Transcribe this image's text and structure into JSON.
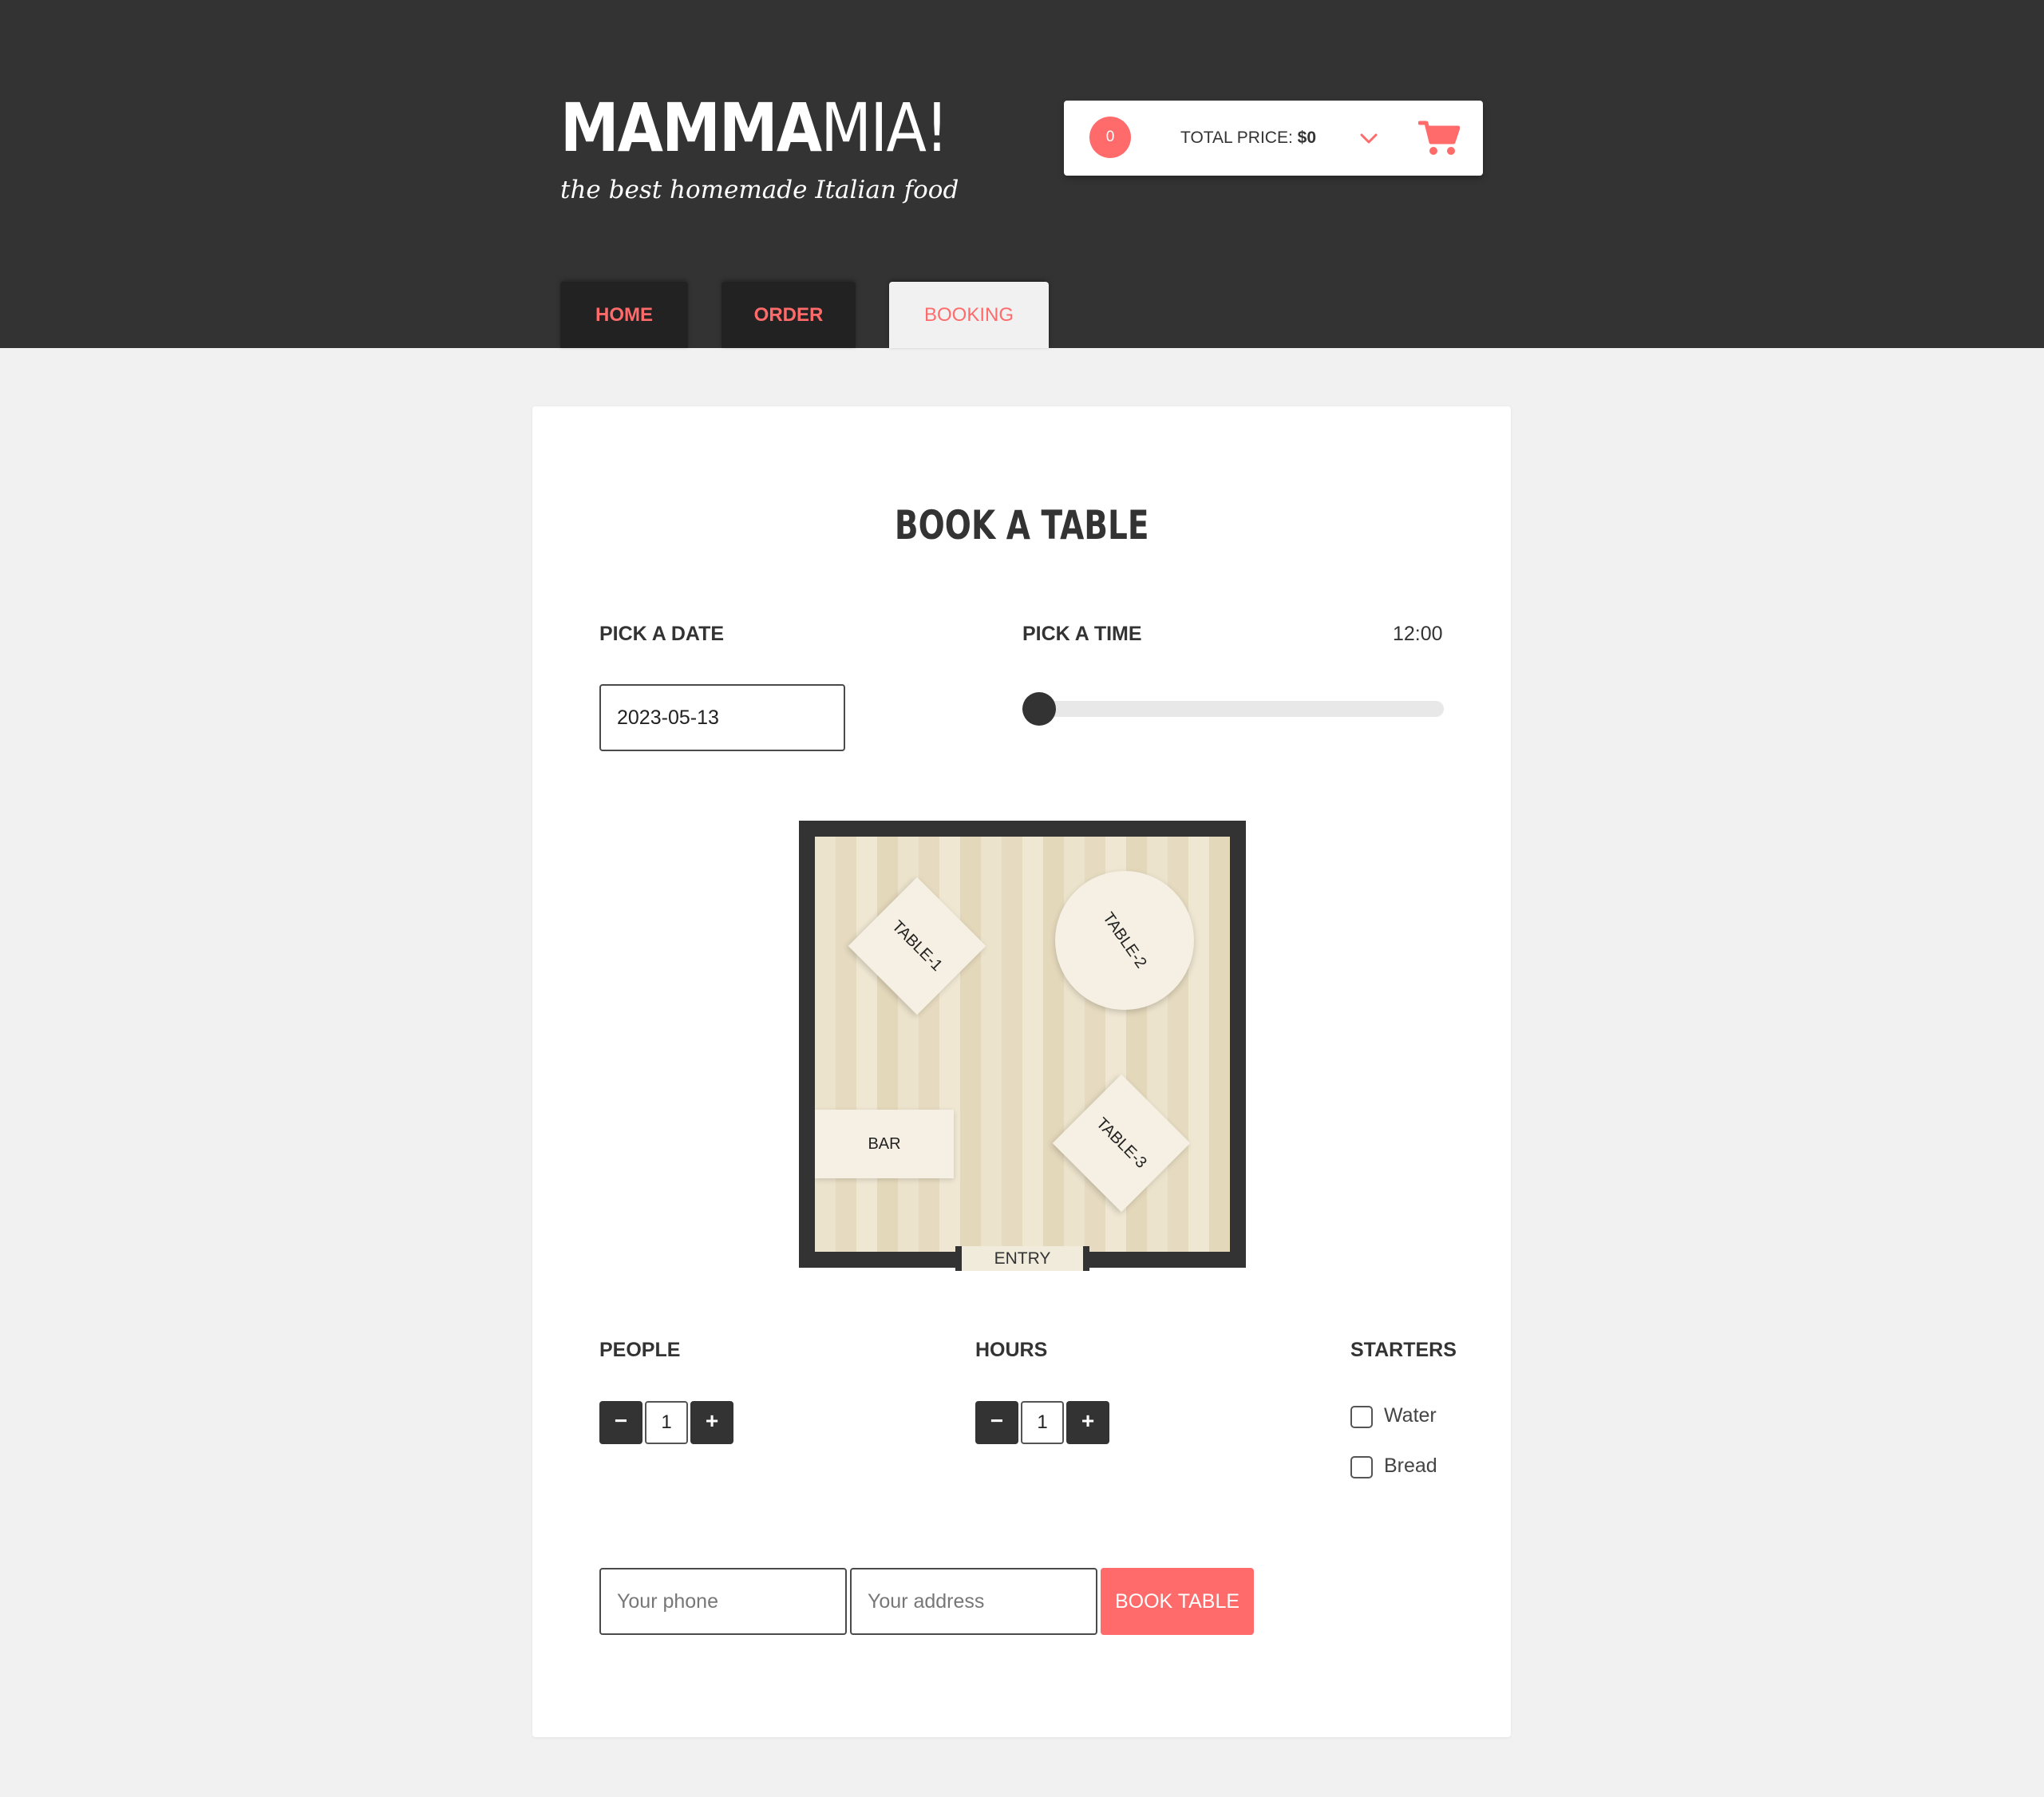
{
  "header": {
    "logo_bold": "MAMMA",
    "logo_light": "MIA!",
    "tagline": "the best homemade Italian food"
  },
  "cart": {
    "count": "0",
    "total_label": "TOTAL PRICE:",
    "total_value": "$0",
    "chevron_icon": "chevron-down-icon",
    "cart_icon": "shopping-cart-icon"
  },
  "nav": {
    "tabs": [
      {
        "label": "HOME",
        "active": false
      },
      {
        "label": "ORDER",
        "active": false
      },
      {
        "label": "BOOKING",
        "active": true
      }
    ]
  },
  "booking": {
    "title": "BOOK A TABLE",
    "date_label": "PICK A DATE",
    "date_value": "2023-05-13",
    "time_label": "PICK A TIME",
    "time_value": "12:00",
    "time_slider_fraction": 0.0,
    "floor": {
      "tables": [
        "TABLE-1",
        "TABLE-2",
        "TABLE-3"
      ],
      "bar": "BAR",
      "entry": "ENTRY"
    },
    "people_label": "PEOPLE",
    "people_value": "1",
    "hours_label": "HOURS",
    "hours_value": "1",
    "minus": "−",
    "plus": "+",
    "starters_label": "STARTERS",
    "starters": [
      "Water",
      "Bread"
    ],
    "phone_placeholder": "Your phone",
    "address_placeholder": "Your address",
    "submit_label": "BOOK TABLE"
  },
  "colors": {
    "accent": "#ff6b6b",
    "dark": "#333333",
    "background": "#f1f1f1"
  }
}
